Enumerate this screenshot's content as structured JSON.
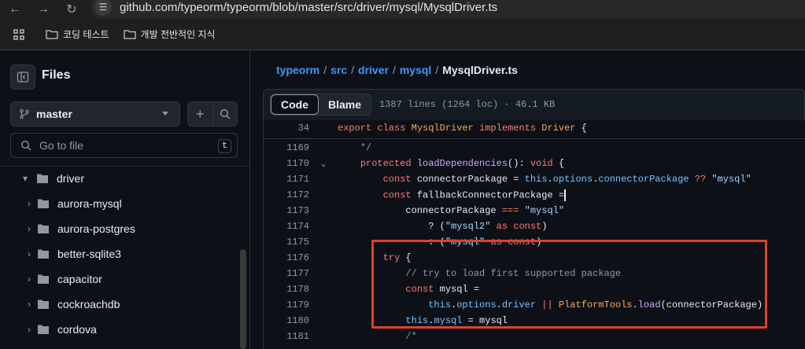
{
  "browser": {
    "url": "github.com/typeorm/typeorm/blob/master/src/driver/mysql/MysqlDriver.ts",
    "bookmarks": [
      {
        "label": "코딩 테스트"
      },
      {
        "label": "개발 전반적인 지식"
      }
    ]
  },
  "sidebar": {
    "title": "Files",
    "branch": "master",
    "goto_placeholder": "Go to file",
    "goto_shortcut": "t",
    "tree": [
      {
        "label": "driver",
        "expanded": true,
        "depth": 1
      },
      {
        "label": "aurora-mysql",
        "depth": 2
      },
      {
        "label": "aurora-postgres",
        "depth": 2
      },
      {
        "label": "better-sqlite3",
        "depth": 2
      },
      {
        "label": "capacitor",
        "depth": 2
      },
      {
        "label": "cockroachdb",
        "depth": 2
      },
      {
        "label": "cordova",
        "depth": 2
      }
    ]
  },
  "breadcrumb": {
    "parts": [
      "typeorm",
      "src",
      "driver",
      "mysql"
    ],
    "separator": "/",
    "current": "MysqlDriver.ts"
  },
  "file_header": {
    "tab_code": "Code",
    "tab_blame": "Blame",
    "meta": "1387 lines (1264 loc) · 46.1 KB"
  },
  "code": {
    "sticky": {
      "num": "34"
    },
    "line_numbers": [
      "1169",
      "1170",
      "1171",
      "1172",
      "1173",
      "1174",
      "1175",
      "1176",
      "1177",
      "1178",
      "1179",
      "1180",
      "1181"
    ]
  },
  "colors": {
    "accent_link": "#4493f8",
    "highlight_box": "#e0412d",
    "background": "#0d1117"
  }
}
